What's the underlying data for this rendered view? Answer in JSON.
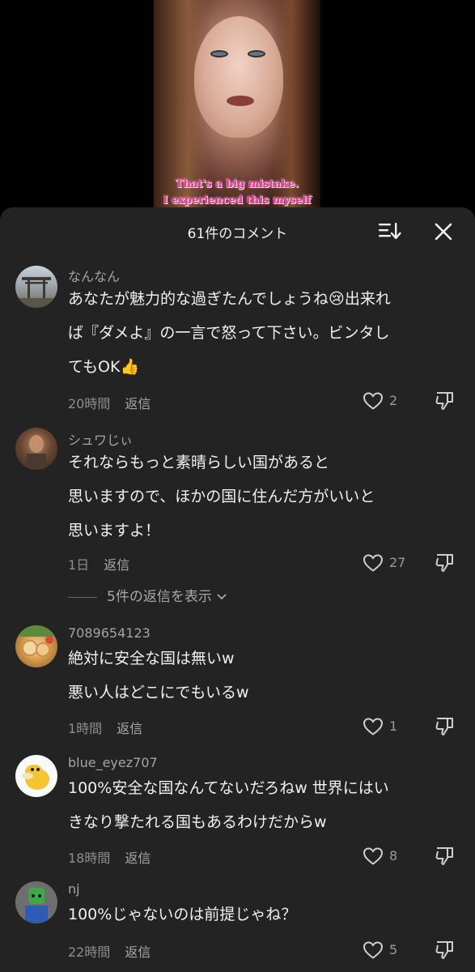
{
  "video": {
    "caption_line1": "That's a big mistake.",
    "caption_line2": "I experienced this myself",
    "caption_color": "#ff2d9a"
  },
  "comments_panel": {
    "title": "61件のコメント",
    "sort_icon": "sort-icon",
    "close_icon": "close-icon"
  },
  "comments": [
    {
      "username": "なんなん",
      "lines": [
        "あなたが魅力的な過ぎたんでしょうね😢出来れ",
        "ば『ダメよ』の一言で怒って下さい。ビンタし",
        "てもOK👍"
      ],
      "time": "20時間",
      "reply_label": "返信",
      "likes": "2"
    },
    {
      "username": "シュワじぃ",
      "lines": [
        "それならもっと素晴らしい国があると",
        "思いますので、ほかの国に住んだ方がいいと",
        "思いますよ！"
      ],
      "time": "1日",
      "reply_label": "返信",
      "likes": "27",
      "view_replies": "5件の返信を表示"
    },
    {
      "username": "7089654123",
      "lines": [
        "絶対に安全な国は無いw",
        "悪い人はどこにでもいるw"
      ],
      "time": "1時間",
      "reply_label": "返信",
      "likes": "1"
    },
    {
      "username": "blue_eyez707",
      "lines": [
        "100%安全な国なんてないだろねw 世界にはい",
        "きなり撃たれる国もあるわけだからw"
      ],
      "time": "18時間",
      "reply_label": "返信",
      "likes": "8"
    },
    {
      "username": "nj",
      "lines": [
        "100%じゃないのは前提じゃね？"
      ],
      "time": "22時間",
      "reply_label": "返信",
      "likes": "5"
    }
  ]
}
